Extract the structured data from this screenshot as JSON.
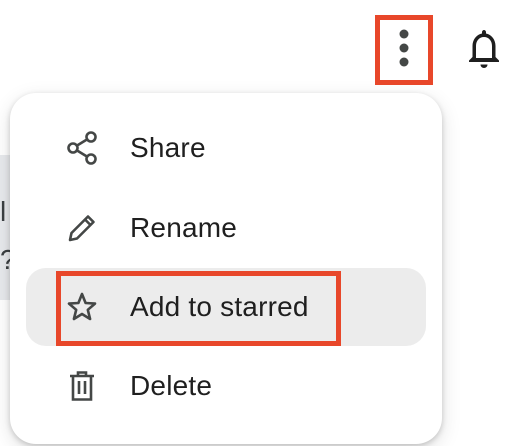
{
  "background": {
    "partial_text": "l\n?"
  },
  "toolbar": {
    "more_icon": "more-vert-icon",
    "bell_icon": "bell-icon"
  },
  "menu": {
    "items": [
      {
        "label": "Share",
        "icon": "share-icon"
      },
      {
        "label": "Rename",
        "icon": "pencil-icon"
      },
      {
        "label": "Add to starred",
        "icon": "star-icon",
        "highlighted": true
      },
      {
        "label": "Delete",
        "icon": "trash-icon"
      }
    ]
  },
  "colors": {
    "highlight_border": "#e8472a",
    "hover_background": "#ececec",
    "text": "#1f1f1f"
  }
}
